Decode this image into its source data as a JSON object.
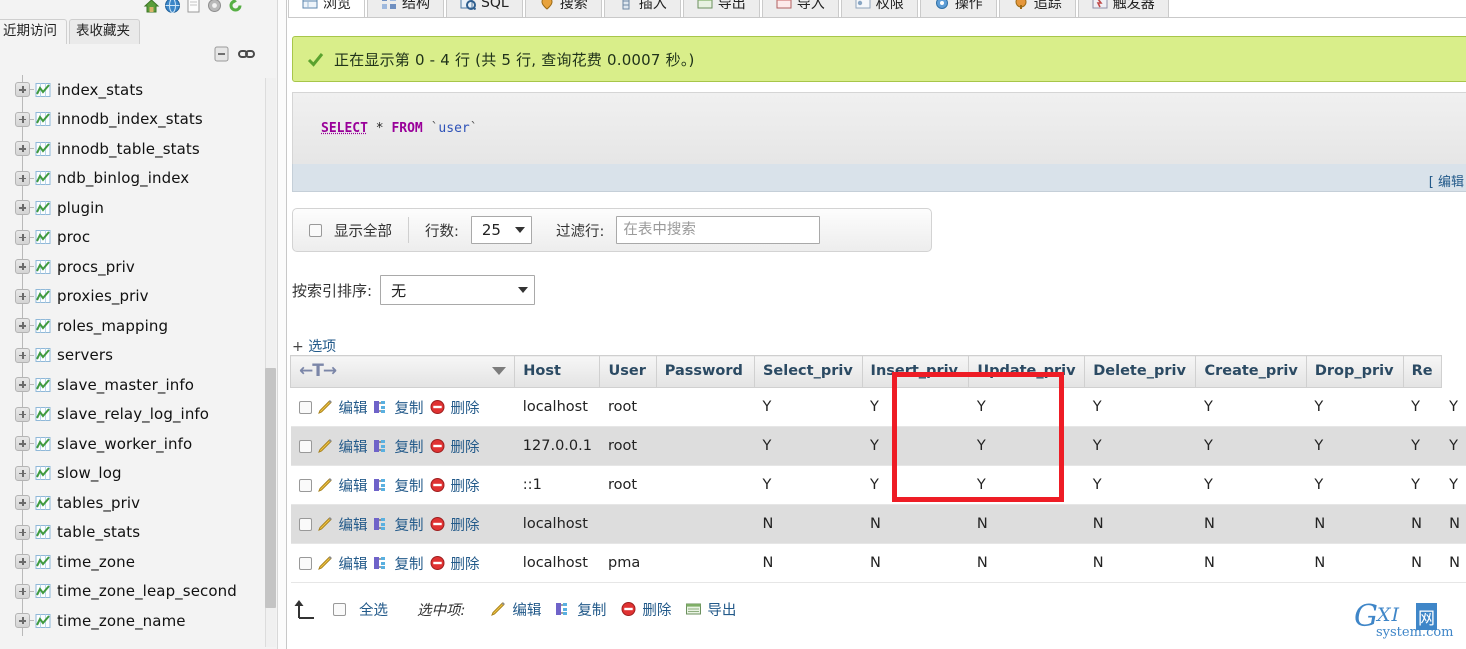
{
  "sidebar": {
    "top_icons": [
      "home-icon",
      "globe-icon",
      "doc-icon",
      "gear-icon",
      "refresh-icon"
    ],
    "tabs": [
      {
        "label": "近期访问",
        "name": "tab-recent",
        "active": true
      },
      {
        "label": "表收藏夹",
        "name": "tab-favorites",
        "active": false
      }
    ],
    "tool_icons": [
      "collapse-all-icon",
      "link-icon"
    ],
    "tables": [
      "index_stats",
      "innodb_index_stats",
      "innodb_table_stats",
      "ndb_binlog_index",
      "plugin",
      "proc",
      "procs_priv",
      "proxies_priv",
      "roles_mapping",
      "servers",
      "slave_master_info",
      "slave_relay_log_info",
      "slave_worker_info",
      "slow_log",
      "tables_priv",
      "table_stats",
      "time_zone",
      "time_zone_leap_second",
      "time_zone_name"
    ]
  },
  "main": {
    "tabs": [
      {
        "label": "浏览",
        "icon": "browse-icon",
        "active": true
      },
      {
        "label": "结构",
        "icon": "structure-icon",
        "active": false
      },
      {
        "label": "SQL",
        "icon": "sql-icon",
        "active": false
      },
      {
        "label": "搜索",
        "icon": "search-icon",
        "active": false
      },
      {
        "label": "插入",
        "icon": "insert-icon",
        "active": false
      },
      {
        "label": "导出",
        "icon": "export-icon",
        "active": false
      },
      {
        "label": "导入",
        "icon": "import-icon",
        "active": false
      },
      {
        "label": "权限",
        "icon": "privileges-icon",
        "active": false
      },
      {
        "label": "操作",
        "icon": "operations-icon",
        "active": false
      },
      {
        "label": "追踪",
        "icon": "tracking-icon",
        "active": false
      },
      {
        "label": "触发器",
        "icon": "triggers-icon",
        "active": false
      }
    ],
    "notice": {
      "text": "正在显示第 0 - 4 行 (共 5 行, 查询花费 0.0007 秒。)",
      "icon": "success-check-icon",
      "bg_color": "#d9ee8a",
      "border_color": "#a7c64a"
    },
    "sql": {
      "keyword_select": "SELECT",
      "asterisk": "*",
      "keyword_from": "FROM",
      "backtick_open": "`",
      "table_name": "user",
      "backtick_close": "`",
      "edit_link": "[ 编辑"
    },
    "options_bar": {
      "show_all_label": "显示全部",
      "rows_label": "行数:",
      "rows_value": "25",
      "filter_label": "过滤行:",
      "filter_placeholder": "在表中搜索",
      "filter_value": ""
    },
    "sort_row": {
      "label": "按索引排序:",
      "value": "无"
    },
    "options_link": {
      "plus": "+",
      "label": "选项"
    },
    "table": {
      "sort_header_glyph": "←T→",
      "columns": [
        "Host",
        "User",
        "Password",
        "Select_priv",
        "Insert_priv",
        "Update_priv",
        "Delete_priv",
        "Create_priv",
        "Drop_priv",
        "Re"
      ],
      "row_actions": [
        {
          "label": "编辑",
          "icon": "pencil-icon"
        },
        {
          "label": "复制",
          "icon": "copy-icon"
        },
        {
          "label": "删除",
          "icon": "delete-icon"
        }
      ],
      "rows": [
        {
          "host": "localhost",
          "user": "root",
          "password": "",
          "privs": [
            "Y",
            "Y",
            "Y",
            "Y",
            "Y",
            "Y",
            "Y",
            "Y"
          ]
        },
        {
          "host": "127.0.0.1",
          "user": "root",
          "password": "",
          "privs": [
            "Y",
            "Y",
            "Y",
            "Y",
            "Y",
            "Y",
            "Y",
            "Y"
          ]
        },
        {
          "host": "::1",
          "user": "root",
          "password": "",
          "privs": [
            "Y",
            "Y",
            "Y",
            "Y",
            "Y",
            "Y",
            "Y",
            "Y"
          ]
        },
        {
          "host": "localhost",
          "user": "",
          "password": "",
          "privs": [
            "N",
            "N",
            "N",
            "N",
            "N",
            "N",
            "N",
            "N"
          ]
        },
        {
          "host": "localhost",
          "user": "pma",
          "password": "",
          "privs": [
            "N",
            "N",
            "N",
            "N",
            "N",
            "N",
            "N",
            "N"
          ]
        }
      ]
    },
    "bottom_bar": {
      "select_all_label": "全选",
      "with_selected_label": "选中项:",
      "actions": [
        {
          "label": "编辑",
          "icon": "pencil-icon"
        },
        {
          "label": "复制",
          "icon": "copy-icon"
        },
        {
          "label": "删除",
          "icon": "delete-icon"
        },
        {
          "label": "导出",
          "icon": "export-icon"
        }
      ]
    },
    "annotation": {
      "color": "#ee1c25",
      "target": "user-password-columns"
    }
  },
  "watermark": {
    "g": "G",
    "xi": "XI",
    "wang": "网",
    "domain": "system.com"
  }
}
